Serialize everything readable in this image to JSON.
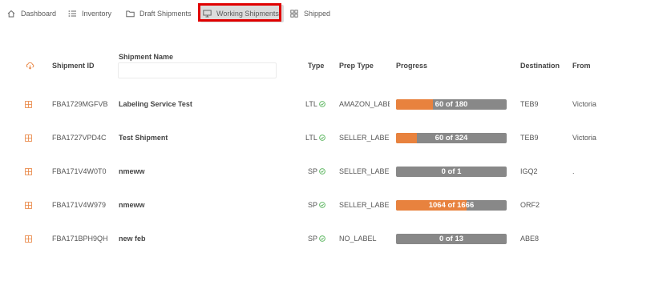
{
  "nav": {
    "dashboard": "Dashboard",
    "inventory": "Inventory",
    "draft": "Draft Shipments",
    "working": "Working Shipments",
    "shipped": "Shipped"
  },
  "table": {
    "headers": {
      "id": "Shipment ID",
      "name": "Shipment Name",
      "type": "Type",
      "prep": "Prep Type",
      "progress": "Progress",
      "destination": "Destination",
      "from": "From"
    },
    "name_filter_value": "",
    "rows": [
      {
        "id": "FBA1729MGFVB",
        "name": "Labeling Service Test",
        "type": "LTL",
        "prep": "AMAZON_LABE",
        "progress_text": "60 of 180",
        "progress_fraction": 0.333,
        "destination": "TEB9",
        "from": "Victoria"
      },
      {
        "id": "FBA1727VPD4C",
        "name": "Test Shipment",
        "type": "LTL",
        "prep": "SELLER_LABEL",
        "progress_text": "60 of 324",
        "progress_fraction": 0.185,
        "destination": "TEB9",
        "from": "Victoria"
      },
      {
        "id": "FBA171V4W0T0",
        "name": "nmeww",
        "type": "SP",
        "prep": "SELLER_LABEL",
        "progress_text": "0 of 1",
        "progress_fraction": 0,
        "destination": "IGQ2",
        "from": "."
      },
      {
        "id": "FBA171V4W979",
        "name": "nmeww",
        "type": "SP",
        "prep": "SELLER_LABEL",
        "progress_text": "1064 of 1666",
        "progress_fraction": 0.639,
        "destination": "ORF2",
        "from": ""
      },
      {
        "id": "FBA171BPH9QH",
        "name": "new feb",
        "type": "SP",
        "prep": "NO_LABEL",
        "progress_text": "0 of 13",
        "progress_fraction": 0,
        "destination": "ABE8",
        "from": ""
      }
    ]
  },
  "colors": {
    "progress_fill": "#e8823e",
    "progress_track": "#888888",
    "check": "#4caf50",
    "highlight": "#e00000"
  }
}
